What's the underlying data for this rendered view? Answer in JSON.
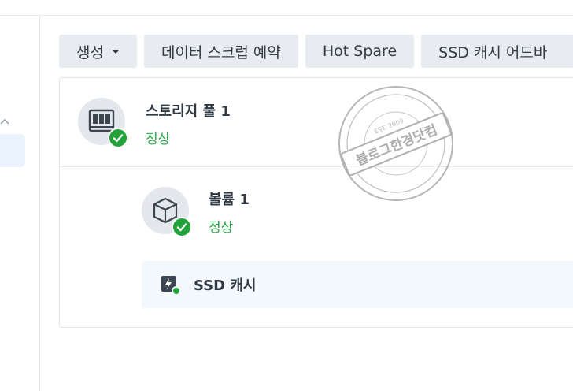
{
  "toolbar": {
    "create_label": "생성",
    "scrub_schedule_label": "데이터 스크럽 예약",
    "hot_spare_label": "Hot Spare",
    "ssd_cache_advisor_label": "SSD 캐시 어드바"
  },
  "storage_pool": {
    "name": "스토리지 풀 1",
    "status": "정상"
  },
  "volume": {
    "name": "볼륨 1",
    "status": "정상"
  },
  "ssd_cache": {
    "label": "SSD 캐시"
  },
  "watermark": {
    "main_text": "블로그한경닷컴",
    "est_text": "EST. 2009"
  },
  "colors": {
    "status_normal": "#28a745",
    "badge_green": "#21a33a",
    "button_bg": "#e8ecf0",
    "selected_nav_bg": "#eaf3fd"
  }
}
